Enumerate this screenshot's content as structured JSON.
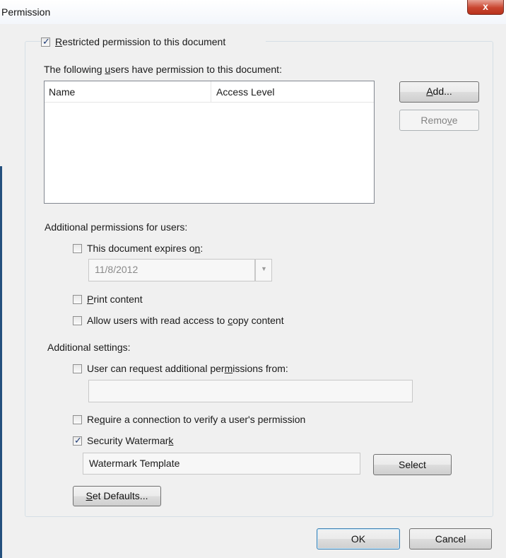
{
  "window": {
    "title": "Permission",
    "close_glyph": "x"
  },
  "restrict": {
    "checked": true,
    "prefix": "",
    "hotkey": "R",
    "suffix": "estricted permission to this document"
  },
  "users": {
    "caption_prefix": "The following ",
    "caption_hotkey": "u",
    "caption_suffix": "sers have permission to this document:",
    "columns": [
      "Name",
      "Access Level"
    ],
    "rows": []
  },
  "buttons": {
    "add": {
      "hotkey": "A",
      "rest": "dd..."
    },
    "remove": {
      "prefix": "Remo",
      "hotkey": "v",
      "suffix": "e"
    },
    "select": "Select",
    "set_defaults": {
      "hotkey": "S",
      "rest": "et Defaults..."
    },
    "ok": "OK",
    "cancel": "Cancel"
  },
  "additional_permissions": {
    "heading": "Additional permissions for users:",
    "expires": {
      "checked": false,
      "prefix": "This document expires o",
      "hotkey": "n",
      "suffix": ":",
      "date": "11/8/2012"
    },
    "print": {
      "checked": false,
      "hotkey": "P",
      "rest": "rint content"
    },
    "copy": {
      "checked": false,
      "prefix": "Allow users with read access to ",
      "hotkey": "c",
      "suffix": "opy content"
    }
  },
  "additional_settings": {
    "heading": "Additional settings:",
    "request": {
      "checked": false,
      "prefix": "User can request additional per",
      "hotkey": "m",
      "suffix": "issions from:",
      "value": ""
    },
    "require": {
      "checked": false,
      "prefix": "Re",
      "hotkey": "q",
      "suffix": "uire a connection to verify a user's permission"
    },
    "watermark": {
      "checked": true,
      "prefix": "Security Watermar",
      "hotkey": "k",
      "suffix": "",
      "template": "Watermark Template"
    }
  },
  "icons": {
    "check": "check-icon",
    "dropdown": "chevron-down-icon",
    "close": "close-icon"
  },
  "colors": {
    "accent_border": "#3c7fb1",
    "close_button": "#c9452f",
    "window_edge": "#24507e"
  }
}
